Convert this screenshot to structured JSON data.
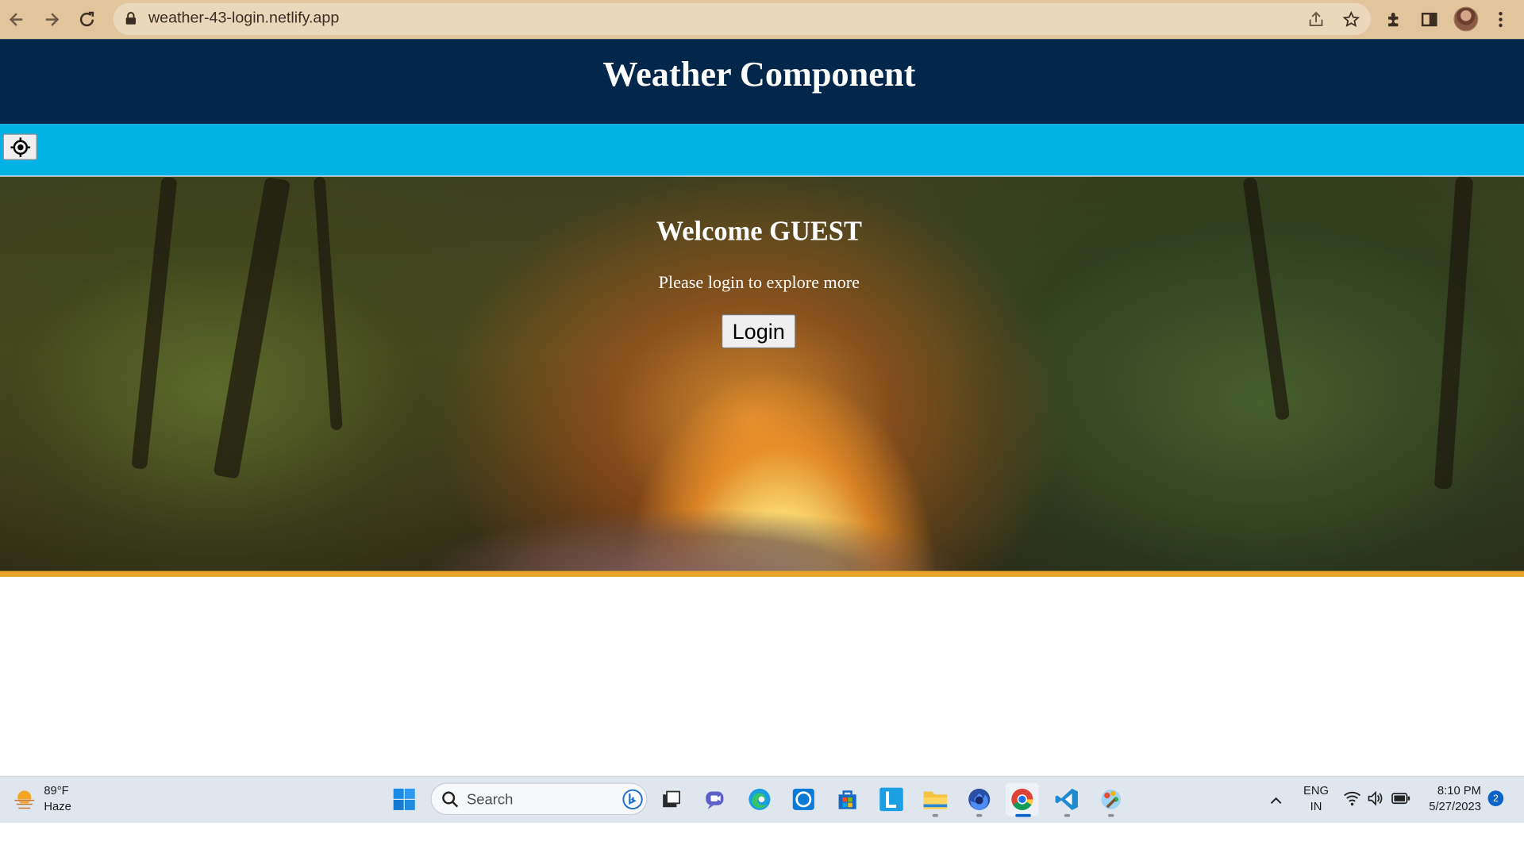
{
  "browser": {
    "url": "weather-43-login.netlify.app",
    "chrome_color": "#e2c49d"
  },
  "header": {
    "title": "Weather Component",
    "bg_color": "#03274a"
  },
  "toolbar": {
    "bar_color": "#02b2e6",
    "location_icon": "crosshair-gps-icon"
  },
  "hero": {
    "welcome": "Welcome GUEST",
    "subtitle": "Please login to explore more",
    "login_label": "Login",
    "accent_color": "#e8a52a"
  },
  "taskbar": {
    "weather": {
      "temp": "89°F",
      "condition": "Haze"
    },
    "search_placeholder": "Search",
    "language": {
      "line1": "ENG",
      "line2": "IN"
    },
    "time": "8:10 PM",
    "date": "5/27/2023",
    "notification_count": "2",
    "apps": [
      "windows-start-icon",
      "task-view-icon",
      "chat-icon",
      "edge-icon",
      "cortana-icon",
      "store-icon",
      "l-app-icon",
      "file-explorer-icon",
      "firefox-icon",
      "chrome-icon",
      "vscode-icon",
      "paint-icon"
    ]
  }
}
